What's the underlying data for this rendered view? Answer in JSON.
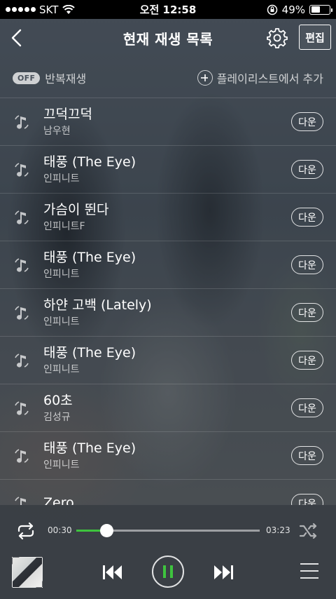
{
  "status_bar": {
    "carrier": "SKT",
    "time": "오전 12:58",
    "battery": "49%"
  },
  "header": {
    "title": "현재 재생 목록",
    "edit_label": "편집"
  },
  "toolbar": {
    "repeat_state": "OFF",
    "repeat_label": "반복재생",
    "add_playlist_label": "플레이리스트에서 추가"
  },
  "songs": [
    {
      "title": "끄덕끄덕",
      "artist": "남우현",
      "action": "다운"
    },
    {
      "title": "태풍 (The Eye)",
      "artist": "인피니트",
      "action": "다운"
    },
    {
      "title": "가슴이 뛴다",
      "artist": "인피니트F",
      "action": "다운"
    },
    {
      "title": "태풍 (The Eye)",
      "artist": "인피니트",
      "action": "다운"
    },
    {
      "title": "하얀 고백 (Lately)",
      "artist": "인피니트",
      "action": "다운"
    },
    {
      "title": "태풍 (The Eye)",
      "artist": "인피니트",
      "action": "다운"
    },
    {
      "title": "60초",
      "artist": "김성규",
      "action": "다운"
    },
    {
      "title": "태풍 (The Eye)",
      "artist": "인피니트",
      "action": "다운"
    },
    {
      "title": "Zero",
      "artist": "",
      "action": "다운"
    }
  ],
  "player": {
    "current_time": "00:30",
    "total_time": "03:23",
    "progress_fraction": 0.166,
    "state": "playing",
    "accent_color": "#3ec43e"
  },
  "icons": {
    "back": "chevron-left-icon",
    "settings": "gear-icon",
    "song": "music-note-icon",
    "repeat": "repeat-icon",
    "shuffle": "shuffle-icon",
    "prev": "skip-previous-icon",
    "pause": "pause-icon",
    "next": "skip-next-icon",
    "menu": "hamburger-menu-icon"
  }
}
